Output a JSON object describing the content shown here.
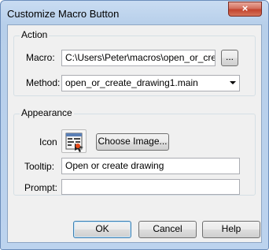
{
  "window": {
    "title": "Customize Macro Button"
  },
  "title_bar": {
    "close_label": "×"
  },
  "action": {
    "legend": "Action",
    "macro_label": "Macro:",
    "macro_value": "C:\\Users\\Peter\\macros\\open_or_create",
    "browse_label": "...",
    "method_label": "Method:",
    "method_value": "open_or_create_drawing1.main"
  },
  "appearance": {
    "legend": "Appearance",
    "icon_label": "Icon",
    "icon_name": "macro-image-icon",
    "choose_image_label": "Choose Image...",
    "tooltip_label": "Tooltip:",
    "tooltip_value": "Open or create drawing",
    "prompt_label": "Prompt:",
    "prompt_value": ""
  },
  "buttons": {
    "ok": "OK",
    "cancel": "Cancel",
    "help": "Help"
  }
}
